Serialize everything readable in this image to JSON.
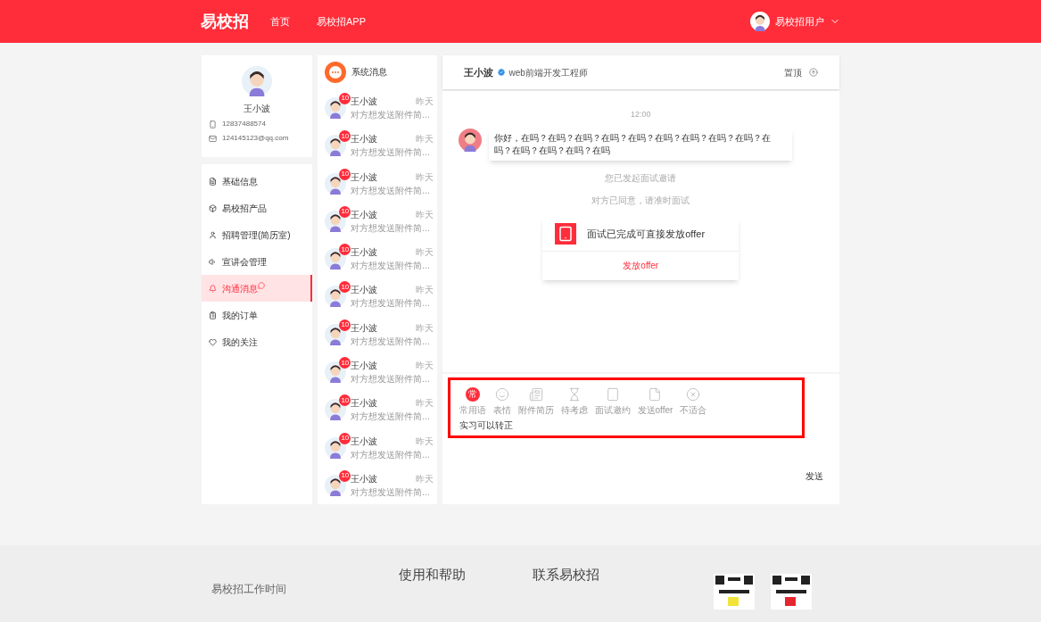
{
  "navbar": {
    "logo": "易校招",
    "links": [
      {
        "label": "首页"
      },
      {
        "label": "易校招APP"
      }
    ],
    "user": "易校招用户"
  },
  "profile": {
    "name": "王小波",
    "phone": "12837488574",
    "email": "124145123@qq.com"
  },
  "menu": [
    {
      "label": "基础信息",
      "selected": false,
      "badge": false
    },
    {
      "label": "易校招产品",
      "selected": false,
      "badge": false
    },
    {
      "label": "招聘管理(简历室)",
      "selected": false,
      "badge": false
    },
    {
      "label": "宣讲会管理",
      "selected": false,
      "badge": false
    },
    {
      "label": "沟通消息",
      "selected": true,
      "badge": true
    },
    {
      "label": "我的订单",
      "selected": false,
      "badge": false
    },
    {
      "label": "我的关注",
      "selected": false,
      "badge": false
    }
  ],
  "system_messages": {
    "label": "系统消息"
  },
  "conversations": [
    {
      "name": "王小波",
      "badge": "10",
      "time": "昨天",
      "preview": "对方想发送附件简..."
    },
    {
      "name": "王小波",
      "badge": "10",
      "time": "昨天",
      "preview": "对方想发送附件简..."
    },
    {
      "name": "王小波",
      "badge": "10",
      "time": "昨天",
      "preview": "对方想发送附件简..."
    },
    {
      "name": "王小波",
      "badge": "10",
      "time": "昨天",
      "preview": "对方想发送附件简..."
    },
    {
      "name": "王小波",
      "badge": "10",
      "time": "昨天",
      "preview": "对方想发送附件简..."
    },
    {
      "name": "王小波",
      "badge": "10",
      "time": "昨天",
      "preview": "对方想发送附件简..."
    },
    {
      "name": "王小波",
      "badge": "10",
      "time": "昨天",
      "preview": "对方想发送附件简..."
    },
    {
      "name": "王小波",
      "badge": "10",
      "time": "昨天",
      "preview": "对方想发送附件简..."
    },
    {
      "name": "王小波",
      "badge": "10",
      "time": "昨天",
      "preview": "对方想发送附件简..."
    },
    {
      "name": "王小波",
      "badge": "10",
      "time": "昨天",
      "preview": "对方想发送附件简..."
    },
    {
      "name": "王小波",
      "badge": "10",
      "time": "昨天",
      "preview": "对方想发送附件简..."
    }
  ],
  "chat": {
    "name": "王小波",
    "verified": true,
    "position": "web前端开发工程师",
    "pin": "置顶",
    "messages": [
      {
        "kind": "time",
        "text": "12:00"
      },
      {
        "kind": "bubble",
        "text": "你好，在吗？在吗？在吗？在吗？在吗？在吗？在吗？在吗？在吗？在吗？在吗？在吗？在吗？在吗"
      },
      {
        "kind": "notice",
        "text": "您已发起面试邀请"
      },
      {
        "kind": "notice",
        "text": "对方已同意，请准时面试"
      },
      {
        "kind": "card",
        "text": "面试已完成可直接发放offer",
        "action": "发放offer"
      }
    ],
    "tools": [
      {
        "label": "常用语",
        "glyph": "常",
        "selected": true
      },
      {
        "label": "表情",
        "selected": false
      },
      {
        "label": "附件简历",
        "selected": false
      },
      {
        "label": "待考虑",
        "selected": false
      },
      {
        "label": "面试邀约",
        "selected": false
      },
      {
        "label": "发送offer",
        "selected": false
      },
      {
        "label": "不适合",
        "selected": false
      }
    ],
    "draft": "实习可以转正",
    "send": "发送"
  },
  "footer": {
    "columns": [
      {
        "title": "易校招工作时间"
      },
      {
        "title": "使用和帮助"
      },
      {
        "title": "联系易校招"
      }
    ]
  }
}
